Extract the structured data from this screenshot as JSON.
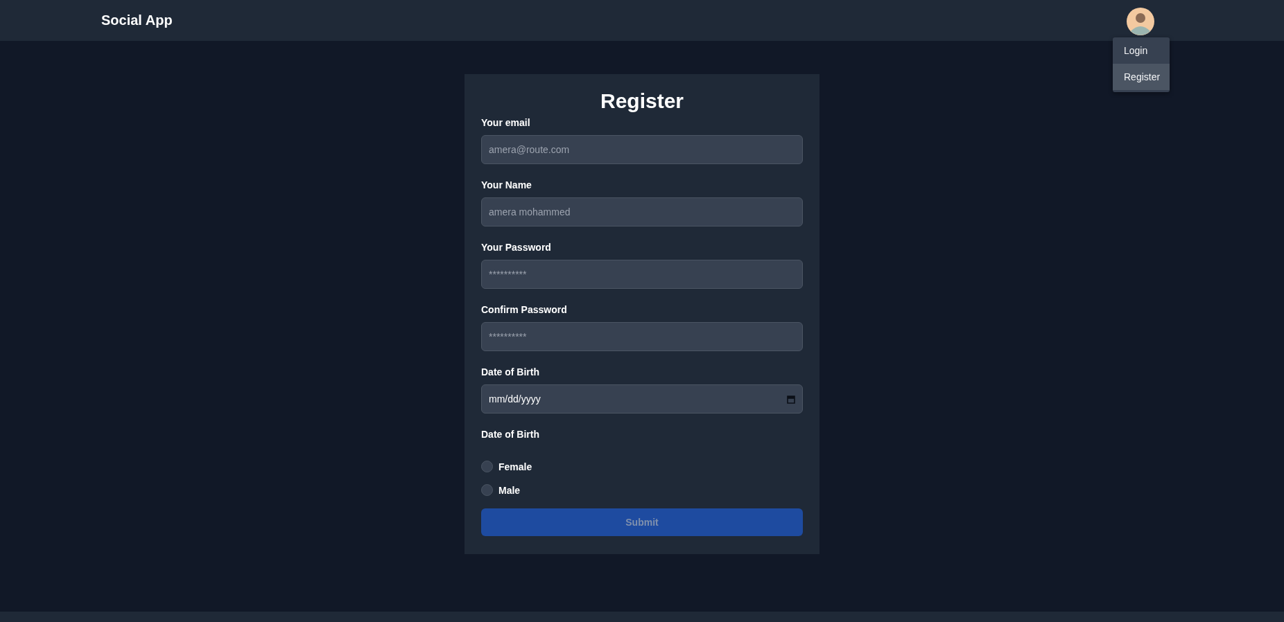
{
  "navbar": {
    "brand": "Social App"
  },
  "user_menu": {
    "items": [
      {
        "label": "Login",
        "selected": false
      },
      {
        "label": "Register",
        "selected": true
      }
    ]
  },
  "form": {
    "title": "Register",
    "fields": [
      {
        "kind": "text",
        "label": "Your email",
        "placeholder": "amera@route.com"
      },
      {
        "kind": "text",
        "label": "Your Name",
        "placeholder": "amera mohammed"
      },
      {
        "kind": "password",
        "label": "Your Password",
        "placeholder": "**********"
      },
      {
        "kind": "password",
        "label": "Confirm Password",
        "placeholder": "**********"
      },
      {
        "kind": "date",
        "label": "Date of Birth",
        "value": "mm/dd/yyyy"
      }
    ],
    "radio_group": {
      "label": "Date of Birth",
      "options": [
        {
          "label": "Female",
          "checked": false
        },
        {
          "label": "Male",
          "checked": false
        }
      ]
    },
    "submit": "Submit"
  }
}
